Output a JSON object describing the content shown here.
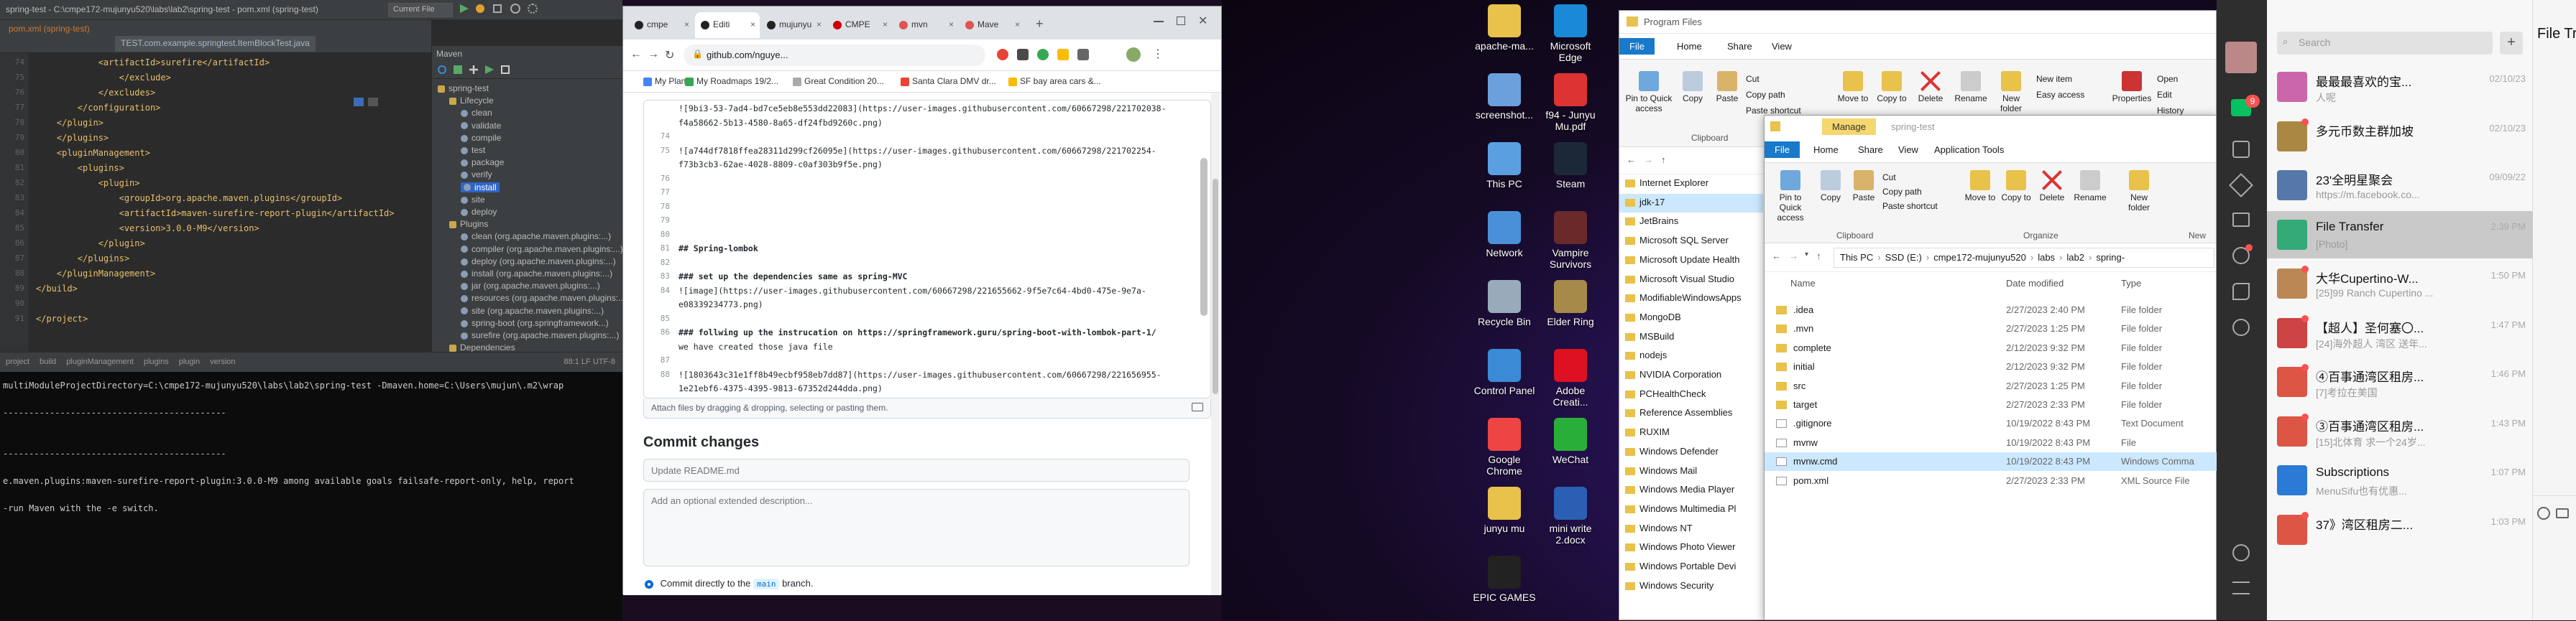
{
  "ide": {
    "title": "spring-test - C:\\cmpe172-mujunyu520\\labs\\lab2\\spring-test - pom.xml (spring-test)",
    "run_config": "Current File",
    "tabs": [
      "pom.xml (spring-test)",
      "TEST.com.example.springtest.ItemBlockTest.java"
    ],
    "code_lines": [
      {
        "n": "74",
        "t": "            <artifactId>surefire</artifactId>"
      },
      {
        "n": "75",
        "t": "                </exclude>"
      },
      {
        "n": "76",
        "t": "            </excludes>"
      },
      {
        "n": "77",
        "t": "        </configuration>"
      },
      {
        "n": "78",
        "t": "    </plugin>"
      },
      {
        "n": "79",
        "t": "    </plugins>"
      },
      {
        "n": "80",
        "t": "    <pluginManagement>"
      },
      {
        "n": "81",
        "t": "        <plugins>"
      },
      {
        "n": "82",
        "t": "            <plugin>"
      },
      {
        "n": "83",
        "t": "                <groupId>org.apache.maven.plugins</groupId>"
      },
      {
        "n": "84",
        "t": "                <artifactId>maven-surefire-report-plugin</artifactId>"
      },
      {
        "n": "85",
        "t": "                <version>3.0.0-M9</version>"
      },
      {
        "n": "86",
        "t": "            </plugin>"
      },
      {
        "n": "87",
        "t": "        </plugins>"
      },
      {
        "n": "88",
        "t": "    </pluginManagement>"
      },
      {
        "n": "89",
        "t": "</build>"
      },
      {
        "n": "90",
        "t": ""
      },
      {
        "n": "91",
        "t": "</project>"
      }
    ],
    "maven": {
      "title": "Maven",
      "items": [
        {
          "label": "spring-test",
          "indent": 0
        },
        {
          "label": "Lifecycle",
          "indent": 1
        },
        {
          "label": "clean",
          "indent": 2
        },
        {
          "label": "validate",
          "indent": 2
        },
        {
          "label": "compile",
          "indent": 2
        },
        {
          "label": "test",
          "indent": 2
        },
        {
          "label": "package",
          "indent": 2
        },
        {
          "label": "verify",
          "indent": 2
        },
        {
          "label": "install",
          "indent": 2
        },
        {
          "label": "site",
          "indent": 2
        },
        {
          "label": "deploy",
          "indent": 2
        },
        {
          "label": "Plugins",
          "indent": 1
        },
        {
          "label": "clean (org.apache.maven.plugins:...)",
          "indent": 2
        },
        {
          "label": "compiler (org.apache.maven.plugins:...)",
          "indent": 2
        },
        {
          "label": "deploy (org.apache.maven.plugins:...)",
          "indent": 2
        },
        {
          "label": "install (org.apache.maven.plugins:...)",
          "indent": 2
        },
        {
          "label": "jar (org.apache.maven.plugins:...)",
          "indent": 2
        },
        {
          "label": "resources (org.apache.maven.plugins:...)",
          "indent": 2
        },
        {
          "label": "site (org.apache.maven.plugins:...)",
          "indent": 2
        },
        {
          "label": "spring-boot (org.springframework...)",
          "indent": 2
        },
        {
          "label": "surefire (org.apache.maven.plugins:...)",
          "indent": 2
        },
        {
          "label": "Dependencies",
          "indent": 1
        }
      ]
    },
    "breadcrumb": [
      "project",
      "build",
      "pluginManagement",
      "plugins",
      "plugin",
      "version"
    ],
    "status": "88:1  LF  UTF-8"
  },
  "terminal": {
    "lines": [
      "multiModuleProjectDirectory=C:\\cmpe172-mujunyu520\\labs\\lab2\\spring-test -Dmaven.home=C:\\Users\\mujun\\.m2\\wrap",
      "",
      "-------------------------------------------",
      "",
      "",
      "-------------------------------------------",
      "",
      "e.maven.plugins:maven-surefire-report-plugin:3.0.0-M9 among available goals failsafe-report-only, help, report",
      "",
      "-run Maven with the -e switch."
    ]
  },
  "chrome": {
    "tabs": [
      {
        "label": "cmpe"
      },
      {
        "label": "Editi"
      },
      {
        "label": "mujunyu"
      },
      {
        "label": "CMPE"
      },
      {
        "label": "mvn"
      },
      {
        "label": "Mave"
      }
    ],
    "url": "github.com/nguye...",
    "bookmarks": [
      "My Plan",
      "My Roadmaps 19/2...",
      "Great Condition 20...",
      "Santa Clara DMV dr...",
      "SF bay area cars &..."
    ],
    "md_lines": [
      {
        "n": "",
        "t": "![9bi3-53-7ad4-bd7ce5eb8e553dd22083](https://user-images.githubusercontent.com/60667298/221702038-"
      },
      {
        "n": "",
        "t": "f4a58662-5b13-4580-8a65-df24fbd9260c.png)"
      },
      {
        "n": "74",
        "t": ""
      },
      {
        "n": "75",
        "t": "![a744df7818ffea28311d299cf26095e](https://user-images.githubusercontent.com/60667298/221702254-"
      },
      {
        "n": "",
        "t": "f73b3cb3-62ae-4028-8809-c0af303b9f5e.png)"
      },
      {
        "n": "76",
        "t": ""
      },
      {
        "n": "77",
        "t": ""
      },
      {
        "n": "78",
        "t": ""
      },
      {
        "n": "79",
        "t": ""
      },
      {
        "n": "80",
        "t": ""
      },
      {
        "n": "81",
        "t": "## Spring-lombok"
      },
      {
        "n": "82",
        "t": ""
      },
      {
        "n": "83",
        "t": "### set up the dependencies same as spring-MVC"
      },
      {
        "n": "84",
        "t": "![image](https://user-images.githubusercontent.com/60667298/221655662-9f5e7c64-4bd0-475e-9e7a-"
      },
      {
        "n": "",
        "t": "e08339234773.png)"
      },
      {
        "n": "85",
        "t": ""
      },
      {
        "n": "86",
        "t": "### follwing up the instrucation on https://springframework.guru/spring-boot-with-lombok-part-1/"
      },
      {
        "n": "",
        "t": "we have created those java file"
      },
      {
        "n": "87",
        "t": ""
      },
      {
        "n": "88",
        "t": "![1803643c31e1ff8b49ecbf958eb7dd87](https://user-images.githubusercontent.com/60667298/221656955-"
      },
      {
        "n": "",
        "t": "1e21ebf6-4375-4395-9813-67352d244dda.png)"
      }
    ],
    "attach_text": "Attach files by dragging & dropping, selecting or pasting them.",
    "commit_heading": "Commit changes",
    "commit_placeholder": "Update README.md",
    "desc_placeholder": "Add an optional extended description...",
    "radio_label_pre": "Commit directly to the",
    "radio_branch": "main",
    "radio_label_post": "branch."
  },
  "desktop": {
    "icons_col1": [
      {
        "label": "apache-ma...",
        "color": "#e8c24a"
      },
      {
        "label": "screenshot...",
        "color": "#6ca0dc"
      },
      {
        "label": "This PC",
        "color": "#5aa0e0"
      },
      {
        "label": "Network",
        "color": "#4a90d9"
      },
      {
        "label": "Recycle Bin",
        "color": "#9ab"
      },
      {
        "label": "Control Panel",
        "color": "#3a8ad6"
      },
      {
        "label": "Google Chrome",
        "color": "#e44"
      },
      {
        "label": "junyu mu",
        "color": "#e8c24a"
      },
      {
        "label": "EPIC GAMES",
        "color": "#222"
      }
    ],
    "icons_col2": [
      {
        "label": "Microsoft Edge",
        "color": "#1b8ad6"
      },
      {
        "label": "f94 - Junyu Mu.pdf",
        "color": "#d33"
      },
      {
        "label": "Steam",
        "color": "#1b2838"
      },
      {
        "label": "Vampire Survivors",
        "color": "#6a2a2a"
      },
      {
        "label": "Elder Ring",
        "color": "#a58a4a"
      },
      {
        "label": "Adobe Creati...",
        "color": "#d12"
      },
      {
        "label": "WeChat",
        "color": "#2aae3a"
      },
      {
        "label": "mini write 2.docx",
        "color": "#2b5fb4"
      }
    ]
  },
  "explorer_back": {
    "path": "Program Files",
    "ribbon_tabs": [
      "File",
      "Home",
      "Share",
      "View"
    ],
    "ribbon_buttons": [
      "Pin to Quick access",
      "Copy",
      "Paste",
      "Move to",
      "Copy to",
      "Delete",
      "Rename",
      "New folder",
      "Properties"
    ],
    "clipboard_items": [
      "Cut",
      "Copy path",
      "Paste shortcut"
    ],
    "new_items": [
      "New item",
      "Easy access"
    ],
    "open_items": [
      "Open",
      "Edit",
      "History"
    ],
    "group_clipboard": "Clipboard",
    "folders": [
      "Internet Explorer",
      "jdk-17",
      "JetBrains",
      "Microsoft SQL Server",
      "Microsoft Update Health",
      "Microsoft Visual Studio",
      "ModifiableWindowsApps",
      "MongoDB",
      "MSBuild",
      "nodejs",
      "NVIDIA Corporation",
      "PCHealthCheck",
      "Reference Assemblies",
      "RUXIM",
      "Windows Defender",
      "Windows Mail",
      "Windows Media Player",
      "Windows Multimedia Pl",
      "Windows NT",
      "Windows Photo Viewer",
      "Windows Portable Devi",
      "Windows Security"
    ]
  },
  "explorer_front": {
    "title": "spring-test",
    "manage_tab": "Manage",
    "ribbon_tabs": [
      "File",
      "Home",
      "Share",
      "View",
      "Application Tools"
    ],
    "ribbon_buttons": [
      "Pin to Quick access",
      "Copy",
      "Paste",
      "Move to",
      "Copy to",
      "Delete",
      "Rename",
      "New folder"
    ],
    "clipboard_items": [
      "Cut",
      "Copy path",
      "Paste shortcut"
    ],
    "group_clipboard": "Clipboard",
    "group_organize": "Organize",
    "group_new": "New",
    "breadcrumb": [
      "This PC",
      "SSD (E:)",
      "cmpe172-mujunyu520",
      "labs",
      "lab2",
      "spring-"
    ],
    "columns": [
      "Name",
      "Date modified",
      "Type"
    ],
    "files": [
      {
        "name": ".idea",
        "date": "2/27/2023 2:40 PM",
        "type": "File folder",
        "kind": "folder"
      },
      {
        "name": ".mvn",
        "date": "2/27/2023 1:25 PM",
        "type": "File folder",
        "kind": "folder"
      },
      {
        "name": "complete",
        "date": "2/12/2023 9:32 PM",
        "type": "File folder",
        "kind": "folder"
      },
      {
        "name": "initial",
        "date": "2/12/2023 9:32 PM",
        "type": "File folder",
        "kind": "folder"
      },
      {
        "name": "src",
        "date": "2/27/2023 1:25 PM",
        "type": "File folder",
        "kind": "folder"
      },
      {
        "name": "target",
        "date": "2/27/2023 2:33 PM",
        "type": "File folder",
        "kind": "folder"
      },
      {
        "name": ".gitignore",
        "date": "10/19/2022 8:43 PM",
        "type": "Text Document",
        "kind": "file"
      },
      {
        "name": "mvnw",
        "date": "10/19/2022 8:43 PM",
        "type": "File",
        "kind": "file"
      },
      {
        "name": "mvnw.cmd",
        "date": "10/19/2022 8:43 PM",
        "type": "Windows Comma",
        "kind": "file"
      },
      {
        "name": "pom.xml",
        "date": "2/27/2023 2:33 PM",
        "type": "XML Source File",
        "kind": "file"
      }
    ]
  },
  "wechat": {
    "search_placeholder": "Search",
    "side_badge": "9",
    "chats": [
      {
        "name": "最最最喜欢的宝...",
        "preview": "人呢",
        "time": "02/10/23",
        "color": "#c6a",
        "badge": false
      },
      {
        "name": "多元币数主群加坡",
        "preview": "",
        "time": "02/10/23",
        "color": "#a84",
        "badge": true
      },
      {
        "name": "23'全明星聚会",
        "preview": "https://m.facebook.co...",
        "time": "09/09/22",
        "color": "#57a",
        "badge": false
      },
      {
        "name": "File Transfer",
        "preview": "[Photo]",
        "time": "2:39 PM",
        "color": "#3a7",
        "badge": false
      },
      {
        "name": "大华Cupertino-W...",
        "preview": "[25]99 Ranch Cupertino ...",
        "time": "1:50 PM",
        "color": "#b85",
        "badge": true
      },
      {
        "name": "【超人】圣何塞〇...",
        "preview": "[24]海外超人 湾区 送年...",
        "time": "1:47 PM",
        "color": "#c44",
        "badge": true
      },
      {
        "name": "④百事通湾区租房...",
        "preview": "[7]考拉在美国",
        "time": "1:46 PM",
        "color": "#d54",
        "badge": true
      },
      {
        "name": "③百事通湾区租房...",
        "preview": "[15]北体育  求一个24岁...",
        "time": "1:43 PM",
        "color": "#d54",
        "badge": true
      },
      {
        "name": "Subscriptions",
        "preview": "MenuSifu也有优惠...",
        "time": "1:07 PM",
        "color": "#2a7ad6",
        "badge": false
      },
      {
        "name": "37》湾区租房二...",
        "preview": "",
        "time": "1:03 PM",
        "color": "#d54",
        "badge": true
      }
    ],
    "main_title": "File Tran"
  }
}
